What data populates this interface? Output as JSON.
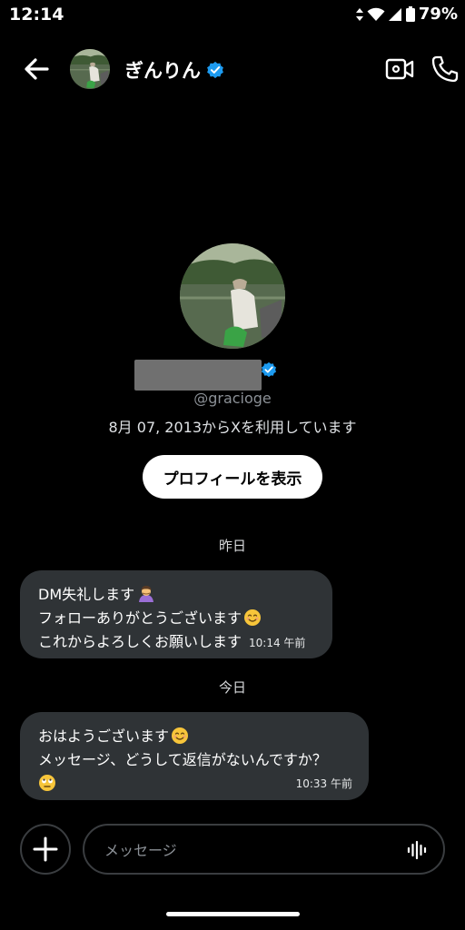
{
  "status": {
    "time": "12:14",
    "battery": "79%"
  },
  "header": {
    "name": "ぎんりん"
  },
  "profile": {
    "handle": "@gracioge",
    "joined": "8月 07, 2013からXを利用しています",
    "view_profile_label": "プロフィールを表示"
  },
  "conversation": {
    "yesterday": {
      "label": "昨日",
      "message": {
        "lines": [
          "DM失礼します",
          "フォローありがとうございます",
          "これからよろしくお願いします"
        ],
        "time": "10:14 午前"
      }
    },
    "today": {
      "label": "今日",
      "message": {
        "lines": [
          "おはようございます",
          "メッセージ、どうして返信がないんですか？"
        ],
        "time": "10:33 午前"
      }
    }
  },
  "composer": {
    "placeholder": "メッセージ"
  },
  "icons": [
    "back-arrow-icon",
    "verified-badge-icon",
    "video-camera-icon",
    "phone-icon",
    "person-bowing-emoji",
    "smiling-face-emoji",
    "face-with-rolling-eyes-emoji",
    "plus-icon",
    "voice-waveform-icon"
  ],
  "colors": {
    "background": "#000000",
    "bubble": "#2f3336",
    "verified": "#1d9bf0",
    "muted": "#8b9096"
  }
}
